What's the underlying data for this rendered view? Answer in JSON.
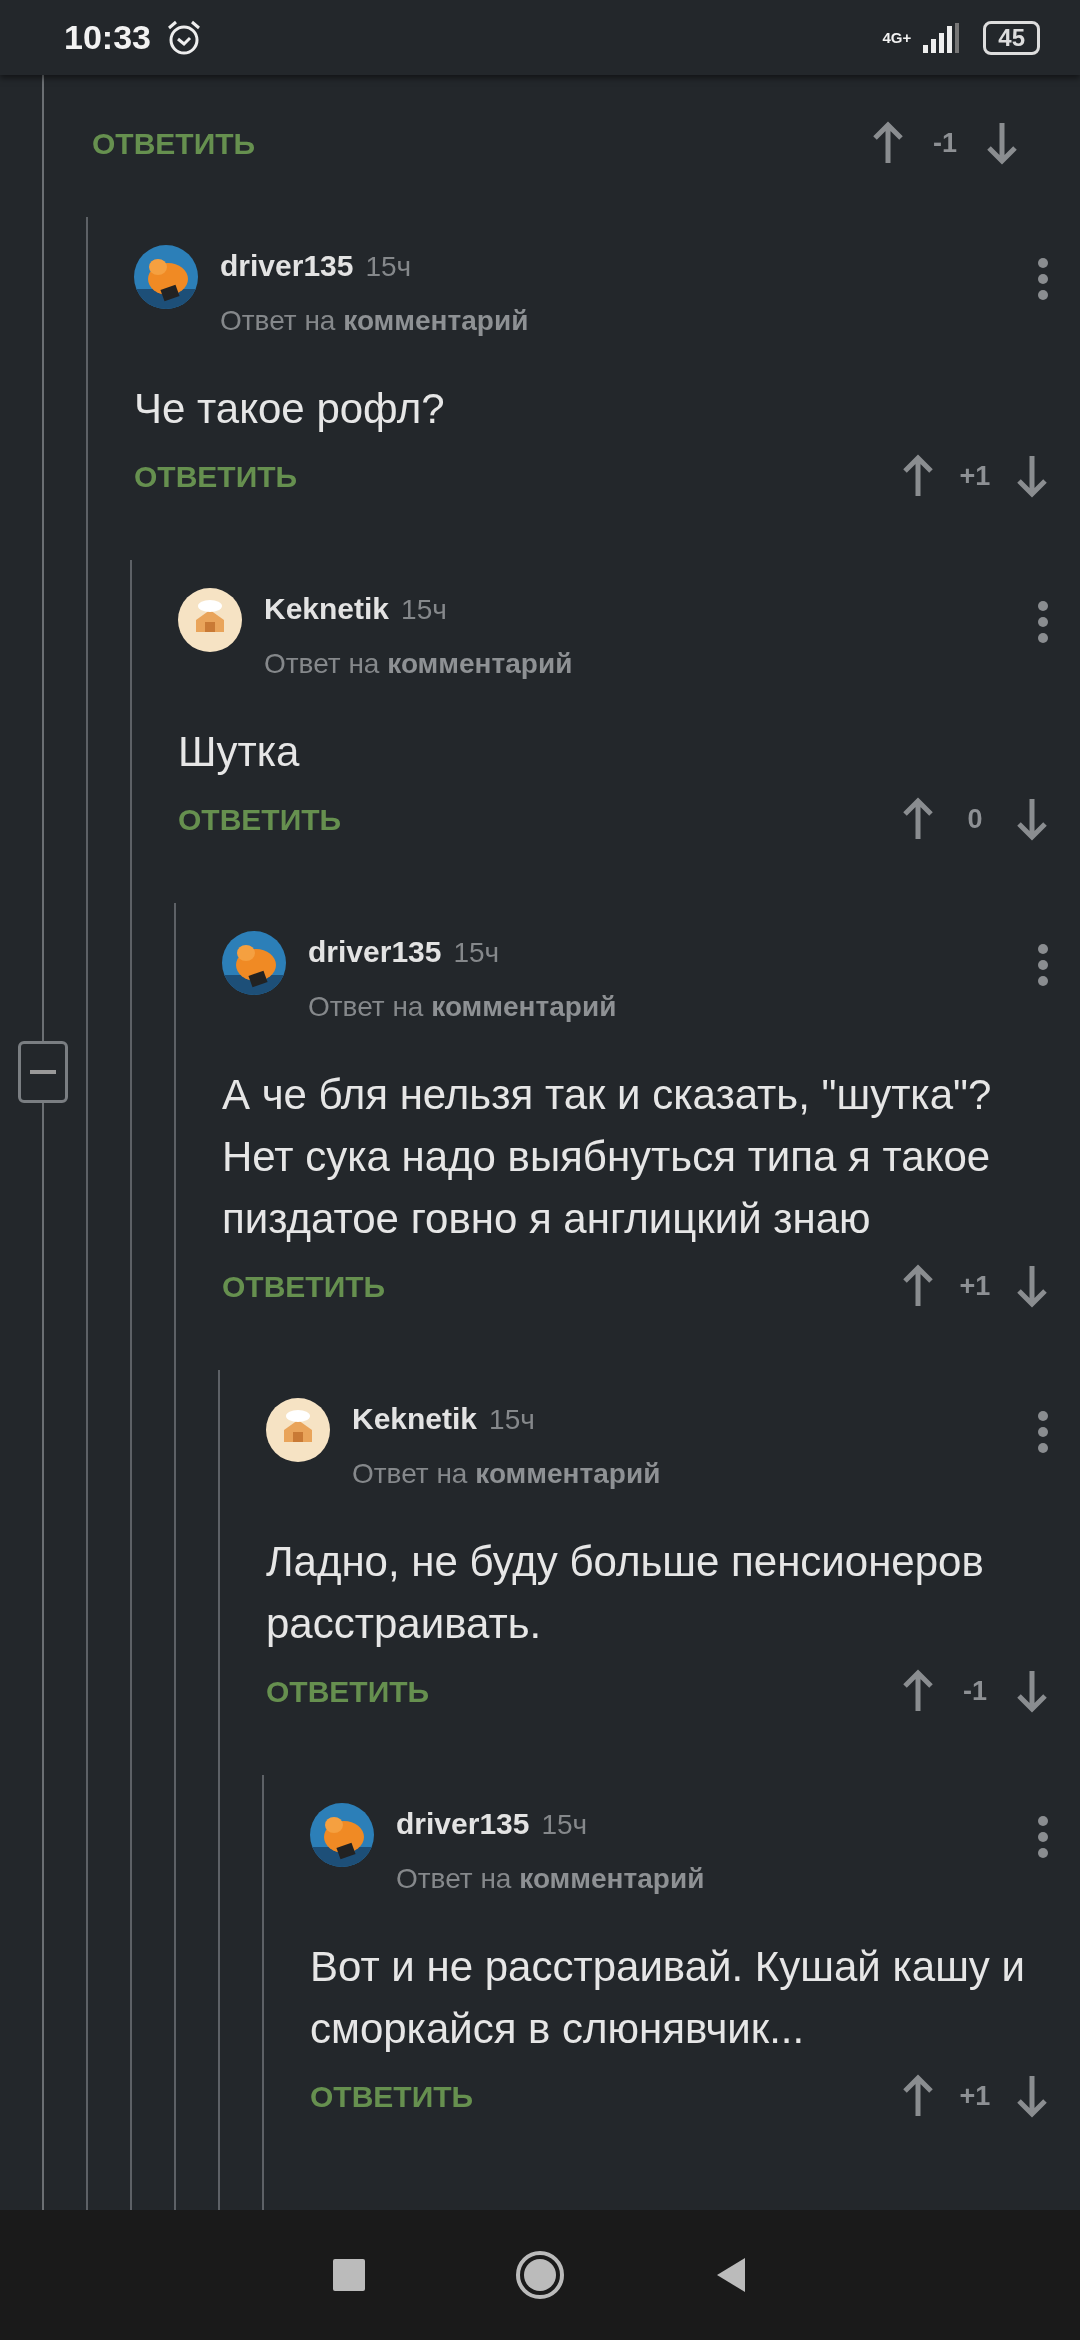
{
  "status_bar": {
    "time": "10:33",
    "network": "4G+",
    "battery": "45"
  },
  "thread": {
    "reply_label": "ОТВЕТИТЬ",
    "score": "-1",
    "replies": [
      {
        "author": "driver135",
        "time": "15ч",
        "avatar": {
          "kind": "creature"
        },
        "reply_prefix": "Ответ на",
        "reply_target": "комментарий",
        "text": "Че такое рофл?",
        "reply_label": "ОТВЕТИТЬ",
        "score": "+1",
        "children": [
          {
            "author": "Keknetik",
            "time": "15ч",
            "avatar": {
              "kind": "house"
            },
            "reply_prefix": "Ответ на",
            "reply_target": "комментарий",
            "text": "Шутка",
            "reply_label": "ОТВЕТИТЬ",
            "score": "0",
            "children": [
              {
                "author": "driver135",
                "time": "15ч",
                "avatar": {
                  "kind": "creature"
                },
                "reply_prefix": "Ответ на",
                "reply_target": "комментарий",
                "text": "А че бля нельзя так и сказать, \"шутка\"? Нет сука надо выябнуться типа я такое пиздатое говно я англицкий знаю",
                "reply_label": "ОТВЕТИТЬ",
                "score": "+1",
                "children": [
                  {
                    "author": "Keknetik",
                    "time": "15ч",
                    "avatar": {
                      "kind": "house"
                    },
                    "reply_prefix": "Ответ на",
                    "reply_target": "комментарий",
                    "text": "Ладно, не буду больше пенсионеров расстраивать.",
                    "reply_label": "ОТВЕТИТЬ",
                    "score": "-1",
                    "children": [
                      {
                        "author": "driver135",
                        "time": "15ч",
                        "avatar": {
                          "kind": "creature"
                        },
                        "reply_prefix": "Ответ на",
                        "reply_target": "комментарий",
                        "text": "Вот и не расстраивай. Кушай кашу и сморкайся в слюнявчик...",
                        "reply_label": "ОТВЕТИТЬ",
                        "score": "+1"
                      }
                    ]
                  }
                ]
              }
            ]
          }
        ]
      }
    ]
  }
}
